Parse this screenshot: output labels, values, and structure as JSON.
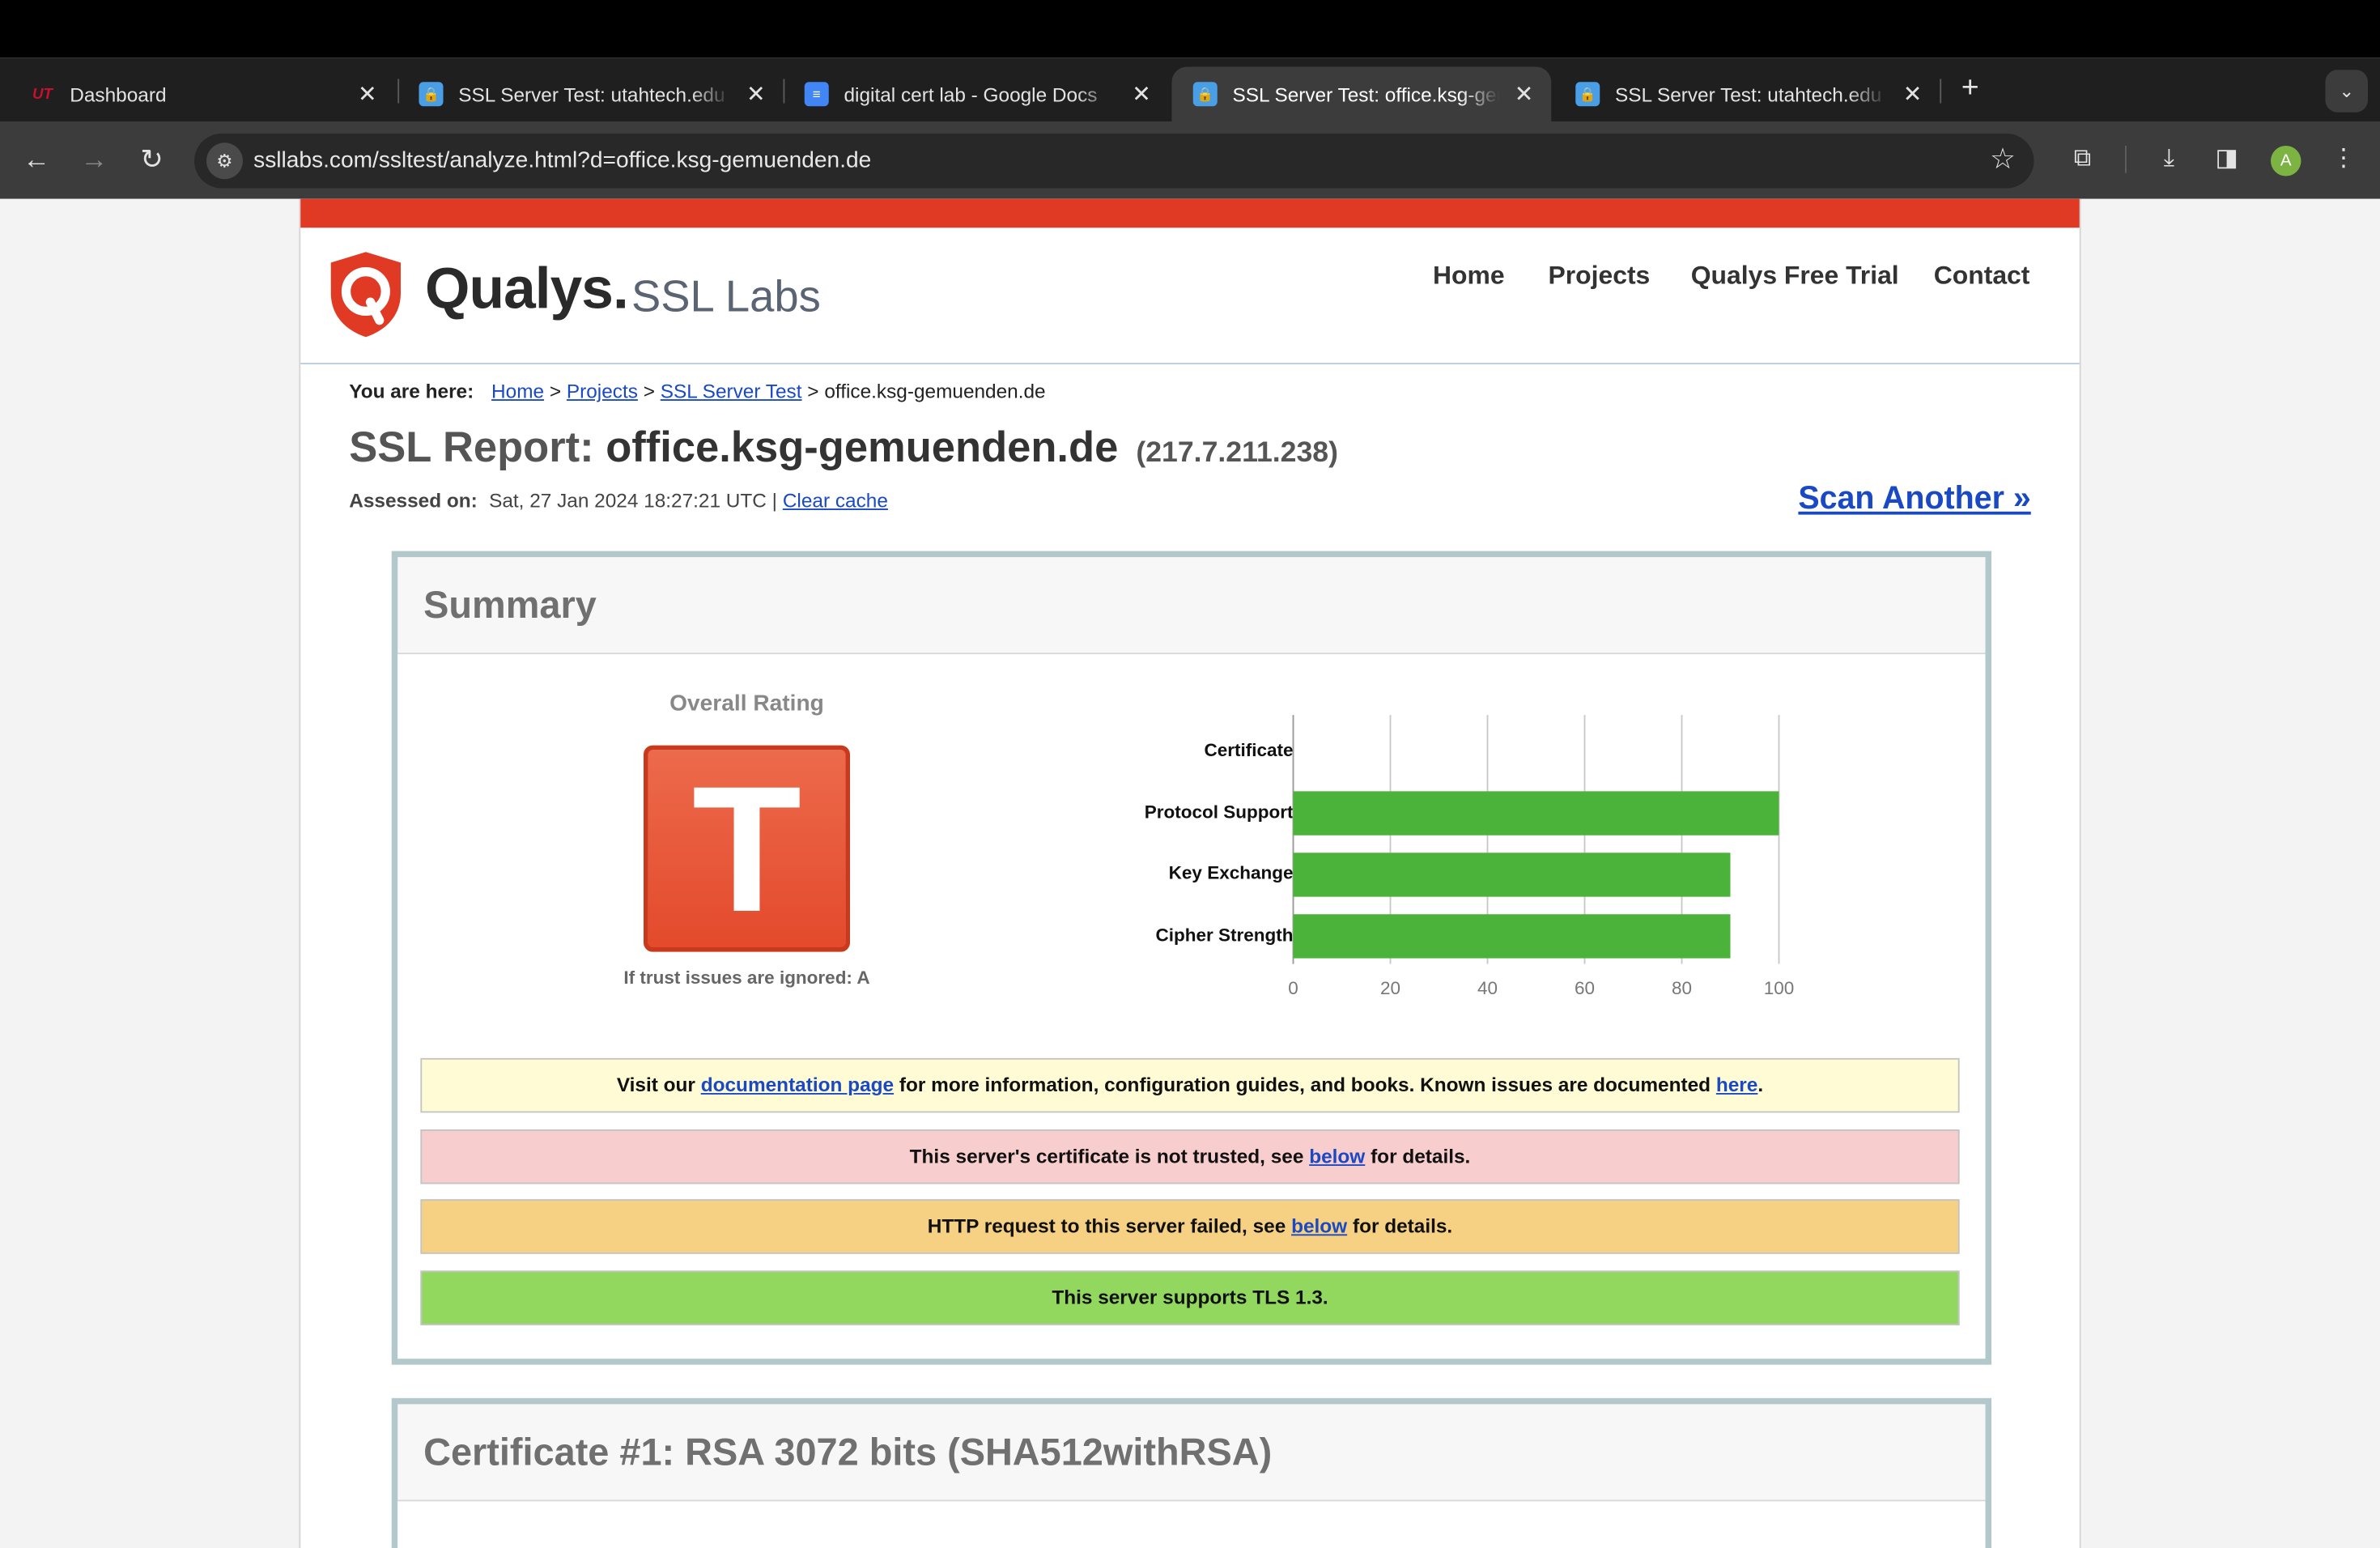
{
  "browser": {
    "tabs": [
      {
        "title": "Dashboard",
        "favicon": "UT",
        "active": false
      },
      {
        "title": "SSL Server Test: utahtech.edu",
        "favicon": "ssl-lock",
        "active": false
      },
      {
        "title": "digital cert lab - Google Docs",
        "favicon": "docs",
        "active": false
      },
      {
        "title": "SSL Server Test: office.ksg-gemuenden.de",
        "favicon": "ssl-lock",
        "active": true
      },
      {
        "title": "SSL Server Test: utahtech.edu",
        "favicon": "ssl-lock",
        "active": false
      }
    ],
    "url": "ssllabs.com/ssltest/analyze.html?d=office.ksg-gemuenden.de",
    "profile_initial": "A"
  },
  "site": {
    "brand": "Qualys.",
    "brand_sub": "SSL Labs",
    "nav": [
      "Home",
      "Projects",
      "Qualys Free Trial",
      "Contact"
    ],
    "accent_color": "#e03a24"
  },
  "breadcrumb": {
    "prefix": "You are here:",
    "links": [
      "Home",
      "Projects",
      "SSL Server Test"
    ],
    "current": "office.ksg-gemuenden.de"
  },
  "report": {
    "title_prefix": "SSL Report:",
    "host": "office.ksg-gemuenden.de",
    "ip": "(217.7.211.238)",
    "assessed_label": "Assessed on:",
    "assessed_value": "Sat, 27 Jan 2024 18:27:21 UTC |",
    "clear_cache": "Clear cache",
    "scan_another": "Scan Another »"
  },
  "summary": {
    "heading": "Summary",
    "overall_rating_label": "Overall Rating",
    "grade": "T",
    "grade_color": "#e44a2c",
    "ignored_note": "If trust issues are ignored: A",
    "messages": {
      "info": {
        "pre": "Visit our",
        "link1": "documentation page",
        "mid": "for more information, configuration guides, and books. Known issues are documented",
        "link2": "here",
        "post": "."
      },
      "trust": {
        "pre": "This server's certificate is not trusted, see",
        "link": "below",
        "post": "for details."
      },
      "http": {
        "pre": "HTTP request to this server failed, see",
        "link": "below",
        "post": "for details."
      },
      "tls": "This server supports TLS 1.3."
    }
  },
  "chart_data": {
    "type": "bar",
    "orientation": "horizontal",
    "categories": [
      "Certificate",
      "Protocol Support",
      "Key Exchange",
      "Cipher Strength"
    ],
    "values": [
      0,
      100,
      90,
      90
    ],
    "xlim": [
      0,
      100
    ],
    "ticks": [
      "0",
      "20",
      "40",
      "60",
      "80",
      "100"
    ],
    "tick_values": [
      0,
      20,
      40,
      60,
      80,
      100
    ],
    "bar_color": "#4cb33a",
    "grid": true
  },
  "certificate": {
    "heading": "Certificate #1: RSA 3072 bits (SHA512withRSA)"
  }
}
